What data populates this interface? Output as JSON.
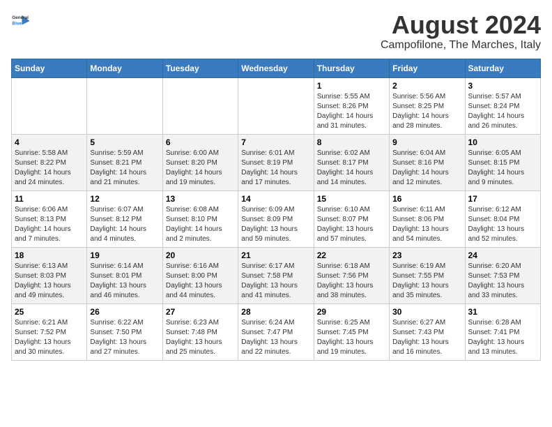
{
  "logo": {
    "general": "General",
    "blue": "Blue"
  },
  "title": "August 2024",
  "subtitle": "Campofilone, The Marches, Italy",
  "days_of_week": [
    "Sunday",
    "Monday",
    "Tuesday",
    "Wednesday",
    "Thursday",
    "Friday",
    "Saturday"
  ],
  "weeks": [
    [
      {
        "day": "",
        "info": ""
      },
      {
        "day": "",
        "info": ""
      },
      {
        "day": "",
        "info": ""
      },
      {
        "day": "",
        "info": ""
      },
      {
        "day": "1",
        "info": "Sunrise: 5:55 AM\nSunset: 8:26 PM\nDaylight: 14 hours\nand 31 minutes."
      },
      {
        "day": "2",
        "info": "Sunrise: 5:56 AM\nSunset: 8:25 PM\nDaylight: 14 hours\nand 28 minutes."
      },
      {
        "day": "3",
        "info": "Sunrise: 5:57 AM\nSunset: 8:24 PM\nDaylight: 14 hours\nand 26 minutes."
      }
    ],
    [
      {
        "day": "4",
        "info": "Sunrise: 5:58 AM\nSunset: 8:22 PM\nDaylight: 14 hours\nand 24 minutes."
      },
      {
        "day": "5",
        "info": "Sunrise: 5:59 AM\nSunset: 8:21 PM\nDaylight: 14 hours\nand 21 minutes."
      },
      {
        "day": "6",
        "info": "Sunrise: 6:00 AM\nSunset: 8:20 PM\nDaylight: 14 hours\nand 19 minutes."
      },
      {
        "day": "7",
        "info": "Sunrise: 6:01 AM\nSunset: 8:19 PM\nDaylight: 14 hours\nand 17 minutes."
      },
      {
        "day": "8",
        "info": "Sunrise: 6:02 AM\nSunset: 8:17 PM\nDaylight: 14 hours\nand 14 minutes."
      },
      {
        "day": "9",
        "info": "Sunrise: 6:04 AM\nSunset: 8:16 PM\nDaylight: 14 hours\nand 12 minutes."
      },
      {
        "day": "10",
        "info": "Sunrise: 6:05 AM\nSunset: 8:15 PM\nDaylight: 14 hours\nand 9 minutes."
      }
    ],
    [
      {
        "day": "11",
        "info": "Sunrise: 6:06 AM\nSunset: 8:13 PM\nDaylight: 14 hours\nand 7 minutes."
      },
      {
        "day": "12",
        "info": "Sunrise: 6:07 AM\nSunset: 8:12 PM\nDaylight: 14 hours\nand 4 minutes."
      },
      {
        "day": "13",
        "info": "Sunrise: 6:08 AM\nSunset: 8:10 PM\nDaylight: 14 hours\nand 2 minutes."
      },
      {
        "day": "14",
        "info": "Sunrise: 6:09 AM\nSunset: 8:09 PM\nDaylight: 13 hours\nand 59 minutes."
      },
      {
        "day": "15",
        "info": "Sunrise: 6:10 AM\nSunset: 8:07 PM\nDaylight: 13 hours\nand 57 minutes."
      },
      {
        "day": "16",
        "info": "Sunrise: 6:11 AM\nSunset: 8:06 PM\nDaylight: 13 hours\nand 54 minutes."
      },
      {
        "day": "17",
        "info": "Sunrise: 6:12 AM\nSunset: 8:04 PM\nDaylight: 13 hours\nand 52 minutes."
      }
    ],
    [
      {
        "day": "18",
        "info": "Sunrise: 6:13 AM\nSunset: 8:03 PM\nDaylight: 13 hours\nand 49 minutes."
      },
      {
        "day": "19",
        "info": "Sunrise: 6:14 AM\nSunset: 8:01 PM\nDaylight: 13 hours\nand 46 minutes."
      },
      {
        "day": "20",
        "info": "Sunrise: 6:16 AM\nSunset: 8:00 PM\nDaylight: 13 hours\nand 44 minutes."
      },
      {
        "day": "21",
        "info": "Sunrise: 6:17 AM\nSunset: 7:58 PM\nDaylight: 13 hours\nand 41 minutes."
      },
      {
        "day": "22",
        "info": "Sunrise: 6:18 AM\nSunset: 7:56 PM\nDaylight: 13 hours\nand 38 minutes."
      },
      {
        "day": "23",
        "info": "Sunrise: 6:19 AM\nSunset: 7:55 PM\nDaylight: 13 hours\nand 35 minutes."
      },
      {
        "day": "24",
        "info": "Sunrise: 6:20 AM\nSunset: 7:53 PM\nDaylight: 13 hours\nand 33 minutes."
      }
    ],
    [
      {
        "day": "25",
        "info": "Sunrise: 6:21 AM\nSunset: 7:52 PM\nDaylight: 13 hours\nand 30 minutes."
      },
      {
        "day": "26",
        "info": "Sunrise: 6:22 AM\nSunset: 7:50 PM\nDaylight: 13 hours\nand 27 minutes."
      },
      {
        "day": "27",
        "info": "Sunrise: 6:23 AM\nSunset: 7:48 PM\nDaylight: 13 hours\nand 25 minutes."
      },
      {
        "day": "28",
        "info": "Sunrise: 6:24 AM\nSunset: 7:47 PM\nDaylight: 13 hours\nand 22 minutes."
      },
      {
        "day": "29",
        "info": "Sunrise: 6:25 AM\nSunset: 7:45 PM\nDaylight: 13 hours\nand 19 minutes."
      },
      {
        "day": "30",
        "info": "Sunrise: 6:27 AM\nSunset: 7:43 PM\nDaylight: 13 hours\nand 16 minutes."
      },
      {
        "day": "31",
        "info": "Sunrise: 6:28 AM\nSunset: 7:41 PM\nDaylight: 13 hours\nand 13 minutes."
      }
    ]
  ]
}
